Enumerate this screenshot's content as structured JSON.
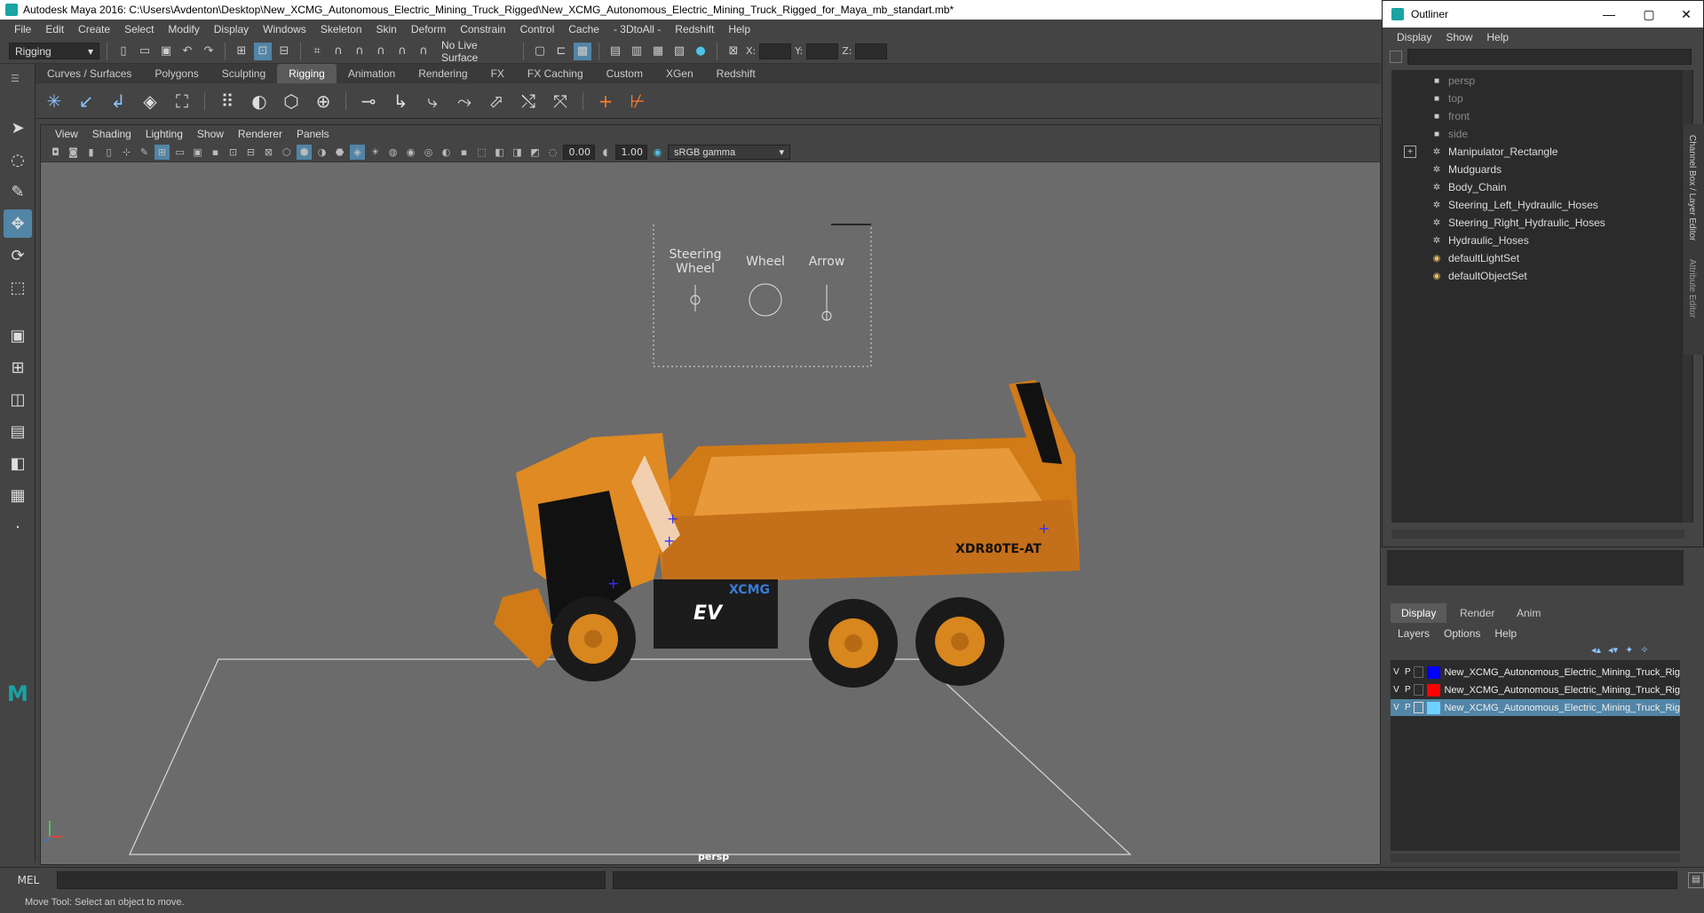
{
  "app": {
    "title": "Autodesk Maya 2016: C:\\Users\\Avdenton\\Desktop\\New_XCMG_Autonomous_Electric_Mining_Truck_Rigged\\New_XCMG_Autonomous_Electric_Mining_Truck_Rigged_for_Maya_mb_standart.mb*"
  },
  "menubar": [
    "File",
    "Edit",
    "Create",
    "Select",
    "Modify",
    "Display",
    "Windows",
    "Skeleton",
    "Skin",
    "Deform",
    "Constrain",
    "Control",
    "Cache",
    "- 3DtoAll -",
    "Redshift",
    "Help"
  ],
  "statusline": {
    "mode": "Rigging",
    "live_surface": "No Live Surface",
    "x_label": "X:",
    "y_label": "Y:",
    "z_label": "Z:"
  },
  "shelf_tabs": [
    {
      "label": "Curves / Surfaces"
    },
    {
      "label": "Polygons"
    },
    {
      "label": "Sculpting"
    },
    {
      "label": "Rigging",
      "active": true
    },
    {
      "label": "Animation"
    },
    {
      "label": "Rendering"
    },
    {
      "label": "FX"
    },
    {
      "label": "FX Caching"
    },
    {
      "label": "Custom"
    },
    {
      "label": "XGen"
    },
    {
      "label": "Redshift"
    }
  ],
  "viewport": {
    "menu": [
      "View",
      "Shading",
      "Lighting",
      "Show",
      "Renderer",
      "Panels"
    ],
    "near_value": "0.00",
    "far_value": "1.00",
    "color_space": "sRGB gamma",
    "camera": "persp",
    "rig_labels": {
      "steering_l1": "Steering",
      "steering_l2": "Wheel",
      "wheel": "Wheel",
      "arrow": "Arrow"
    },
    "truck_model": "XDR80TE-AT",
    "truck_brand": "XCMG",
    "truck_ev": "EV",
    "colors": {
      "truck": "#e08a1e",
      "viewport_bg": "#6b6b6b"
    }
  },
  "outliner": {
    "title": "Outliner",
    "menu": [
      "Display",
      "Show",
      "Help"
    ],
    "items": [
      {
        "label": "persp",
        "icon": "camera-icon",
        "dim": true
      },
      {
        "label": "top",
        "icon": "camera-icon",
        "dim": true
      },
      {
        "label": "front",
        "icon": "camera-icon",
        "dim": true
      },
      {
        "label": "side",
        "icon": "camera-icon",
        "dim": true
      },
      {
        "label": "Manipulator_Rectangle",
        "icon": "transform-icon",
        "expand": true
      },
      {
        "label": "Mudguards",
        "icon": "transform-icon"
      },
      {
        "label": "Body_Chain",
        "icon": "transform-icon"
      },
      {
        "label": "Steering_Left_Hydraulic_Hoses",
        "icon": "transform-icon"
      },
      {
        "label": "Steering_Right_Hydraulic_Hoses",
        "icon": "transform-icon"
      },
      {
        "label": "Hydraulic_Hoses",
        "icon": "transform-icon"
      },
      {
        "label": "defaultLightSet",
        "icon": "set-icon"
      },
      {
        "label": "defaultObjectSet",
        "icon": "set-icon"
      }
    ]
  },
  "side_strip": {
    "channel_box": "Channel Box / Layer Editor",
    "attribute_editor": "Attribute Editor"
  },
  "layers": {
    "tabs": [
      "Display",
      "Render",
      "Anim"
    ],
    "menu": [
      "Layers",
      "Options",
      "Help"
    ],
    "rows": [
      {
        "v": "V",
        "p": "P",
        "color": "#0000ff",
        "name": "New_XCMG_Autonomous_Electric_Mining_Truck_Rig"
      },
      {
        "v": "V",
        "p": "P",
        "color": "#ff0000",
        "name": "New_XCMG_Autonomous_Electric_Mining_Truck_Rig"
      },
      {
        "v": "V",
        "p": "P",
        "color": "#6fd0ff",
        "name": "New_XCMG_Autonomous_Electric_Mining_Truck_Rig",
        "selected": true
      }
    ]
  },
  "cmdline": {
    "label": "MEL"
  },
  "helpline": {
    "text": "Move Tool: Select an object to move."
  }
}
